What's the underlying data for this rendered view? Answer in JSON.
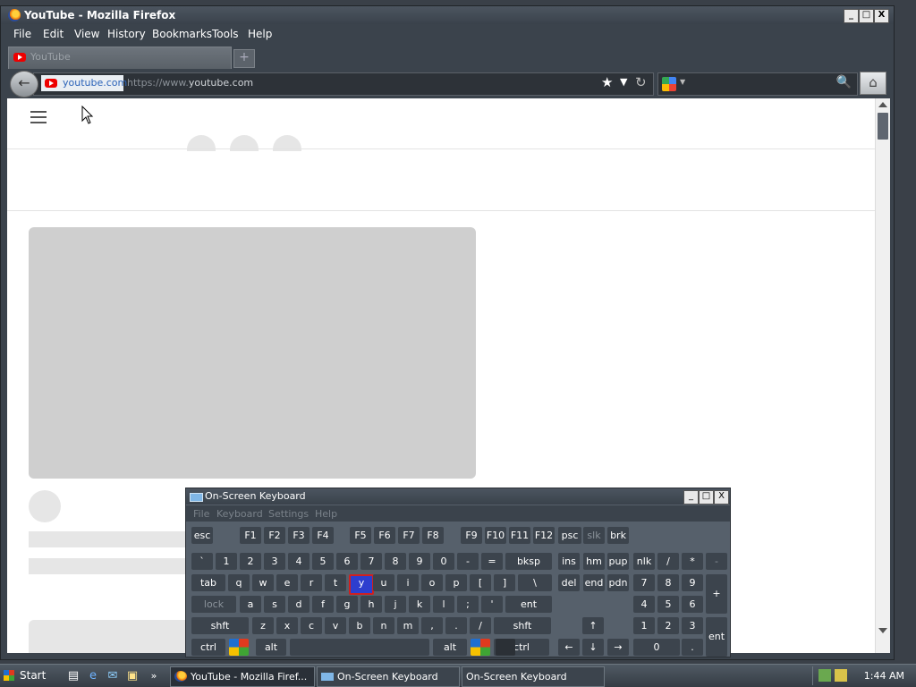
{
  "firefox": {
    "title": "YouTube - Mozilla Firefox",
    "window_buttons": [
      "_",
      "□",
      "X"
    ],
    "menu": [
      "File",
      "Edit",
      "View",
      "History",
      "Bookmarks",
      "Tools",
      "Help"
    ],
    "tab": {
      "label": "YouTube",
      "new_tab_symbol": "+"
    },
    "nav": {
      "site_identity": "youtube.com",
      "url_prefix": "https://www.",
      "url_domain": "youtube.com",
      "search_placeholder": ""
    }
  },
  "osk": {
    "title": "On-Screen Keyboard",
    "window_buttons": [
      "_",
      "□",
      "X"
    ],
    "menu": [
      "File",
      "Keyboard",
      "Settings",
      "Help"
    ],
    "rows": {
      "fn": [
        "esc",
        "F1",
        "F2",
        "F3",
        "F4",
        "F5",
        "F6",
        "F7",
        "F8",
        "F9",
        "F10",
        "F11",
        "F12",
        "psc",
        "slk",
        "brk"
      ],
      "num": [
        "`",
        "1",
        "2",
        "3",
        "4",
        "5",
        "6",
        "7",
        "8",
        "9",
        "0",
        "-",
        "=",
        "bksp",
        "ins",
        "hm",
        "pup",
        "nlk",
        "/",
        "*",
        "-"
      ],
      "tab": [
        "tab",
        "q",
        "w",
        "e",
        "r",
        "t",
        "y",
        "u",
        "i",
        "o",
        "p",
        "[",
        "]",
        "\\",
        "del",
        "end",
        "pdn",
        "7",
        "8",
        "9",
        "+"
      ],
      "home": [
        "lock",
        "a",
        "s",
        "d",
        "f",
        "g",
        "h",
        "j",
        "k",
        "l",
        ";",
        "'",
        "ent",
        "4",
        "5",
        "6"
      ],
      "shift": [
        "shft",
        "z",
        "x",
        "c",
        "v",
        "b",
        "n",
        "m",
        ",",
        ".",
        "/",
        "shft",
        "↑",
        "1",
        "2",
        "3",
        "ent"
      ],
      "bottom": [
        "ctrl",
        "alt",
        "alt",
        "ctrl",
        "←",
        "↓",
        "→",
        "0",
        "."
      ]
    },
    "highlighted_key": "y"
  },
  "taskbar": {
    "start": "Start",
    "buttons": [
      "YouTube - Mozilla Firef...",
      "On-Screen Keyboard",
      "On-Screen Keyboard"
    ],
    "clock": "1:44 AM"
  }
}
